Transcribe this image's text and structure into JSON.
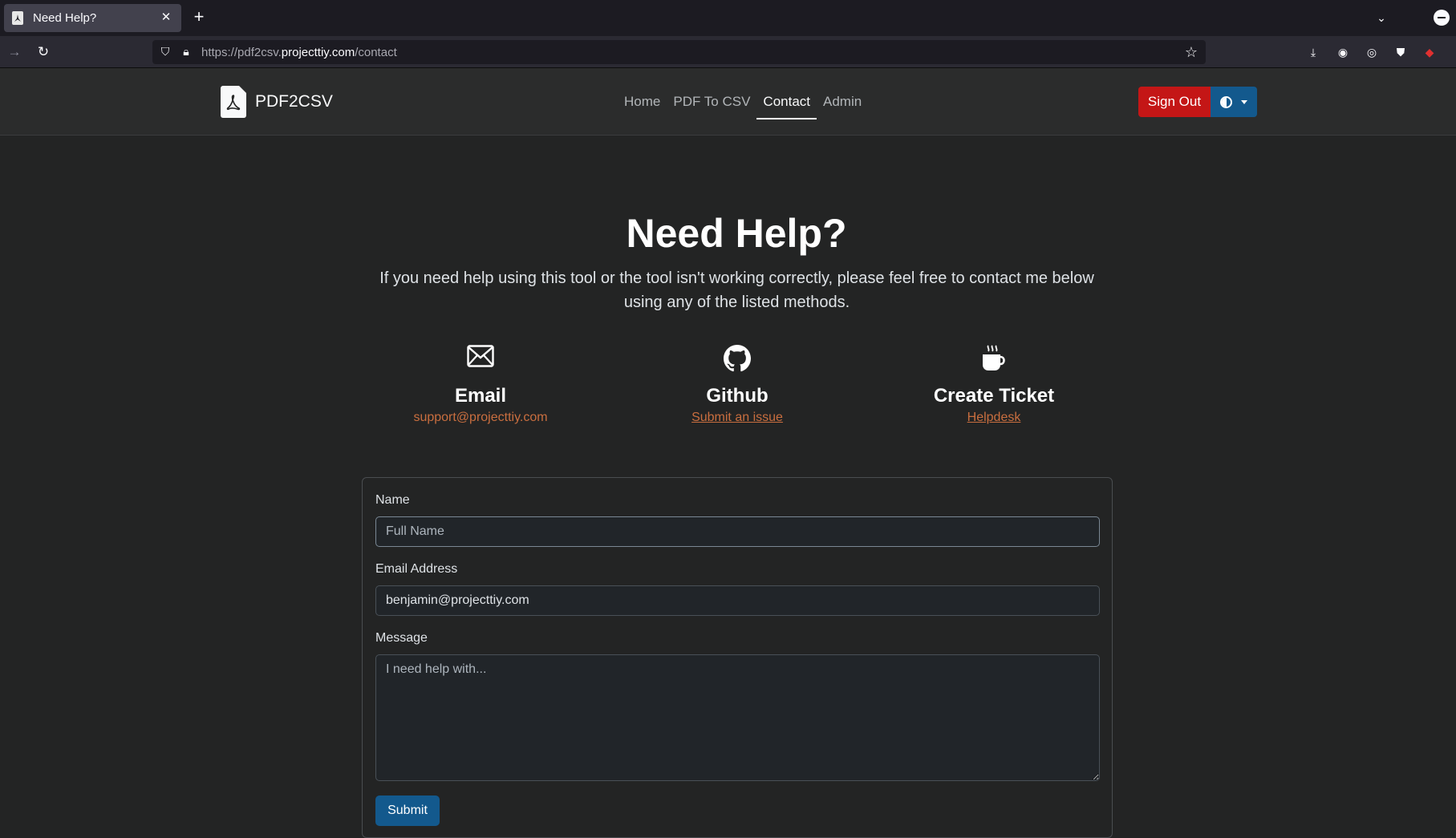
{
  "browser": {
    "tab_title": "Need Help?",
    "url_prefix": "https://pdf2csv.",
    "url_host": "projecttiy.com",
    "url_path": "/contact"
  },
  "site": {
    "brand": "PDF2CSV",
    "nav": [
      "Home",
      "PDF To CSV",
      "Contact",
      "Admin"
    ],
    "active_nav": "Contact",
    "sign_out": "Sign Out"
  },
  "hero": {
    "title": "Need Help?",
    "lead": "If you need help using this tool or the tool isn't working correctly, please feel free to contact me below using any of the listed methods."
  },
  "contact_methods": [
    {
      "title": "Email",
      "link": "support@projecttiy.com",
      "icon": "envelope-icon"
    },
    {
      "title": "Github",
      "link": "Submit an issue",
      "icon": "github-icon"
    },
    {
      "title": "Create Ticket",
      "link": "Helpdesk",
      "icon": "cup-icon"
    }
  ],
  "form": {
    "name_label": "Name",
    "name_placeholder": "Full Name",
    "name_value": "",
    "email_label": "Email Address",
    "email_value": "benjamin@projecttiy.com",
    "message_label": "Message",
    "message_placeholder": "I need help with...",
    "submit": "Submit"
  },
  "colors": {
    "accent_link": "#c96e3f",
    "danger": "#c41616",
    "primary": "#13598d",
    "background": "#232424"
  }
}
